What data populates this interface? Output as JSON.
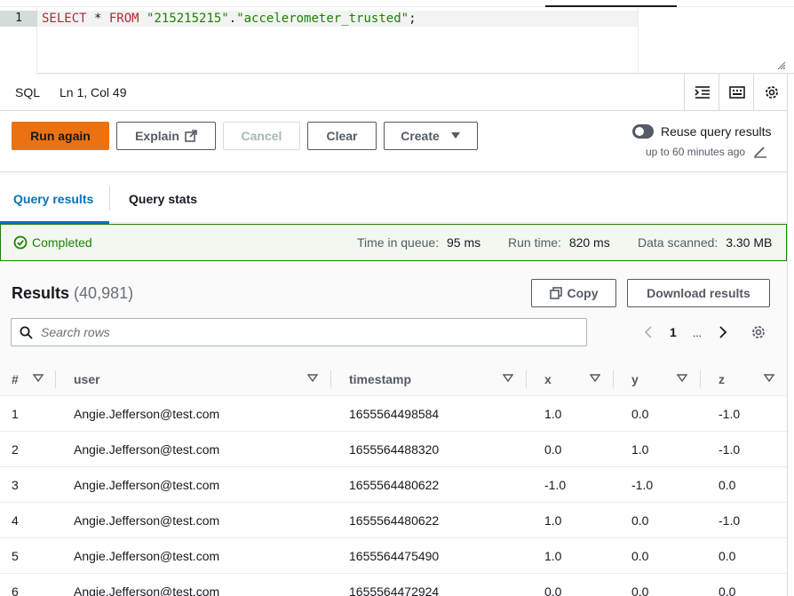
{
  "editor": {
    "line_number": "1",
    "query_keyword_select": "SELECT",
    "query_star": " * ",
    "query_keyword_from": "FROM",
    "query_db": "\"215215215\"",
    "query_dot": ".",
    "query_table": "\"accelerometer_trusted\"",
    "query_end": ";"
  },
  "statusbar": {
    "language": "SQL",
    "cursor": "Ln 1, Col 49"
  },
  "actions": {
    "run_again": "Run again",
    "explain": "Explain",
    "cancel": "Cancel",
    "clear": "Clear",
    "create": "Create",
    "reuse_label": "Reuse query results",
    "reuse_sub": "up to 60 minutes ago"
  },
  "tabs": {
    "query_results": "Query results",
    "query_stats": "Query stats"
  },
  "banner": {
    "status": "Completed",
    "queue_label": "Time in queue:",
    "queue_value": "95 ms",
    "run_label": "Run time:",
    "run_value": "820 ms",
    "scanned_label": "Data scanned:",
    "scanned_value": "3.30 MB"
  },
  "results": {
    "title": "Results",
    "count": "(40,981)",
    "copy": "Copy",
    "download": "Download results",
    "search_placeholder": "Search rows",
    "page": "1",
    "ellipsis": "..."
  },
  "table": {
    "columns": [
      "#",
      "user",
      "timestamp",
      "x",
      "y",
      "z"
    ],
    "rows": [
      [
        "1",
        "Angie.Jefferson@test.com",
        "1655564498584",
        "1.0",
        "0.0",
        "-1.0"
      ],
      [
        "2",
        "Angie.Jefferson@test.com",
        "1655564488320",
        "0.0",
        "1.0",
        "-1.0"
      ],
      [
        "3",
        "Angie.Jefferson@test.com",
        "1655564480622",
        "-1.0",
        "-1.0",
        "0.0"
      ],
      [
        "4",
        "Angie.Jefferson@test.com",
        "1655564480622",
        "1.0",
        "0.0",
        "-1.0"
      ],
      [
        "5",
        "Angie.Jefferson@test.com",
        "1655564475490",
        "1.0",
        "0.0",
        "0.0"
      ],
      [
        "6",
        "Angie.Jefferson@test.com",
        "1655564472924",
        "0.0",
        "0.0",
        "0.0"
      ]
    ]
  },
  "colors": {
    "primary": "#ec7211",
    "link": "#0073bb",
    "success": "#1d8102"
  }
}
